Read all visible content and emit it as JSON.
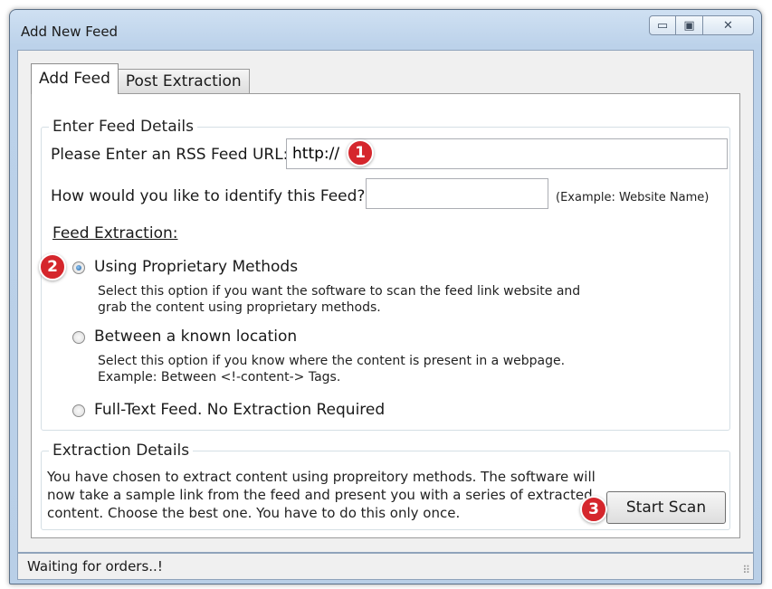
{
  "window": {
    "title": "Add New Feed",
    "min_glyph": "▭",
    "max_glyph": "▣",
    "close_glyph": "✕"
  },
  "tabs": [
    {
      "label": "Add Feed",
      "active": true
    },
    {
      "label": "Post Extraction",
      "active": false
    }
  ],
  "feed_details": {
    "group_label": "Enter Feed Details",
    "url_label": "Please Enter an RSS Feed URL:",
    "url_value": "http://",
    "name_label": "How would you like to identify this Feed?",
    "name_value": "",
    "name_hint": "(Example: Website Name)",
    "extraction_heading": "Feed Extraction:",
    "options": [
      {
        "label": "Using Proprietary Methods",
        "checked": true,
        "desc_1": "Select this option if you want the software to scan the feed link website and",
        "desc_2": "grab the content using proprietary methods."
      },
      {
        "label": "Between a known location",
        "checked": false,
        "desc_1": "Select this option if you know where the content is present in a webpage.",
        "desc_2": "Example: Between <!-content-> Tags."
      },
      {
        "label": "Full-Text Feed. No Extraction Required",
        "checked": false
      }
    ]
  },
  "extraction_details": {
    "group_label": "Extraction Details",
    "line_1": "You have chosen to extract content using propreitory methods. The software will",
    "line_2": "now take a sample link from the feed and present you with a series of extracted",
    "line_3": "content. Choose the best one. You have to do this only once.",
    "button_label": "Start Scan"
  },
  "markers": [
    "1",
    "2",
    "3"
  ],
  "status": {
    "text": "Waiting for orders..!",
    "grip": "⠿"
  },
  "colors": {
    "marker": "#d5262c",
    "title_bar": "#bcd2ea"
  }
}
